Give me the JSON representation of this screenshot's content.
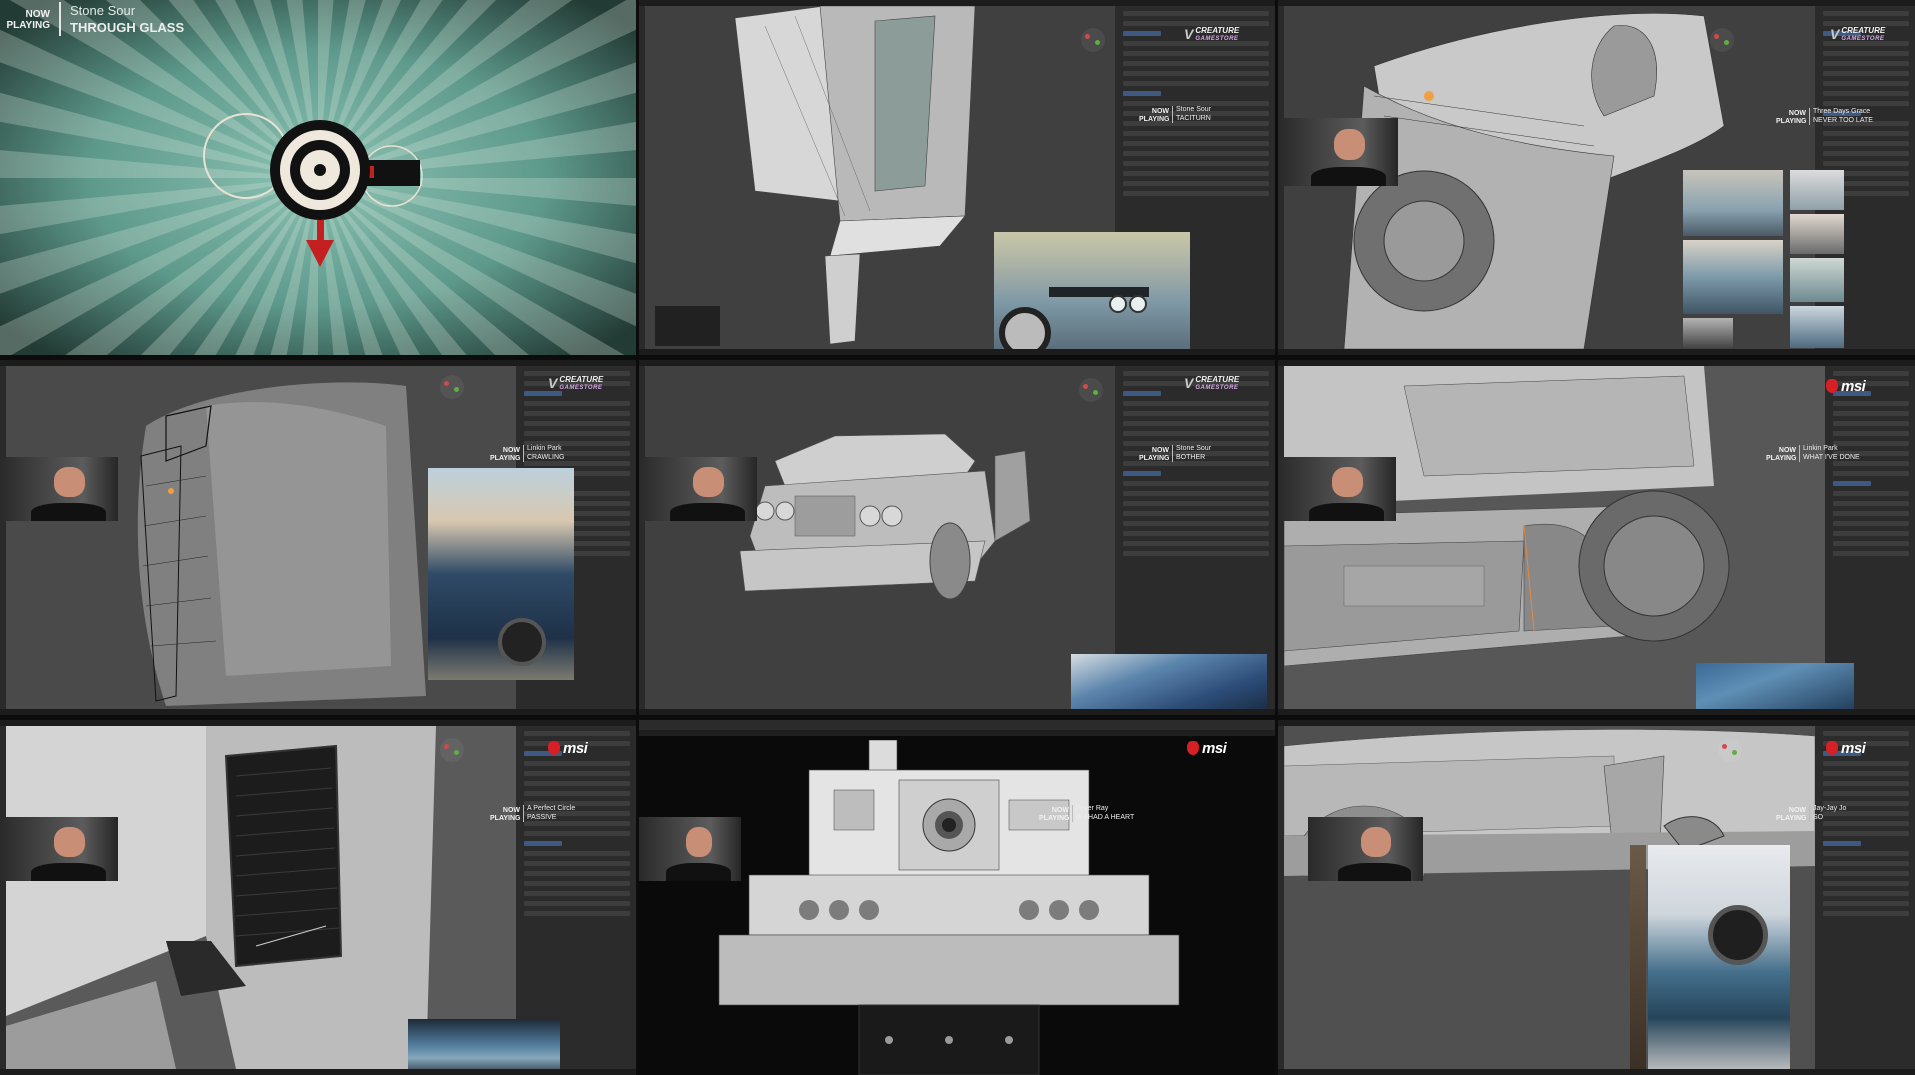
{
  "overlay": {
    "now_playing": "NOW PLAYING",
    "msi_logo": "msi",
    "creature_logo": {
      "line1": "CREATURE",
      "line2": "GAMESTORE"
    }
  },
  "colors": {
    "teal_bg": "#5e9a8c",
    "msi_red": "#d71f26",
    "blender_bg": "#404040",
    "panel": "#2b2b2b",
    "select_blue": "#3e5a82"
  },
  "tiles": [
    {
      "id": "intro",
      "artist": "Stone Sour",
      "song": "THROUGH GLASS",
      "logo": "eye-emblem"
    },
    {
      "id": "doorframe",
      "artist": "Stone Sour",
      "song": "TACITURN",
      "logo": "creature-logo",
      "reference": "audi-quattro-front"
    },
    {
      "id": "rear-fender",
      "artist": "Three Days Grace",
      "song": "NEVER TOO LATE",
      "logo": "creature-logo"
    },
    {
      "id": "wireframe",
      "artist": "Linkin Park",
      "song": "CRAWLING",
      "logo": "creature-logo"
    },
    {
      "id": "car-overview",
      "artist": "Stone Sour",
      "song": "BOTHER",
      "logo": "creature-logo"
    },
    {
      "id": "side-skirt",
      "artist": "Linkin Park",
      "song": "WHAT I'VE DONE",
      "logo": "msi"
    },
    {
      "id": "vent-grille",
      "artist": "A Perfect Circle",
      "song": "PASSIVE",
      "logo": "msi"
    },
    {
      "id": "tank",
      "artist": "Fever Ray",
      "song": "IF I HAD A HEART",
      "logo": "msi"
    },
    {
      "id": "wheel-arch",
      "artist": "Jay-Jay Jo",
      "song": "SO",
      "logo": "msi"
    }
  ]
}
